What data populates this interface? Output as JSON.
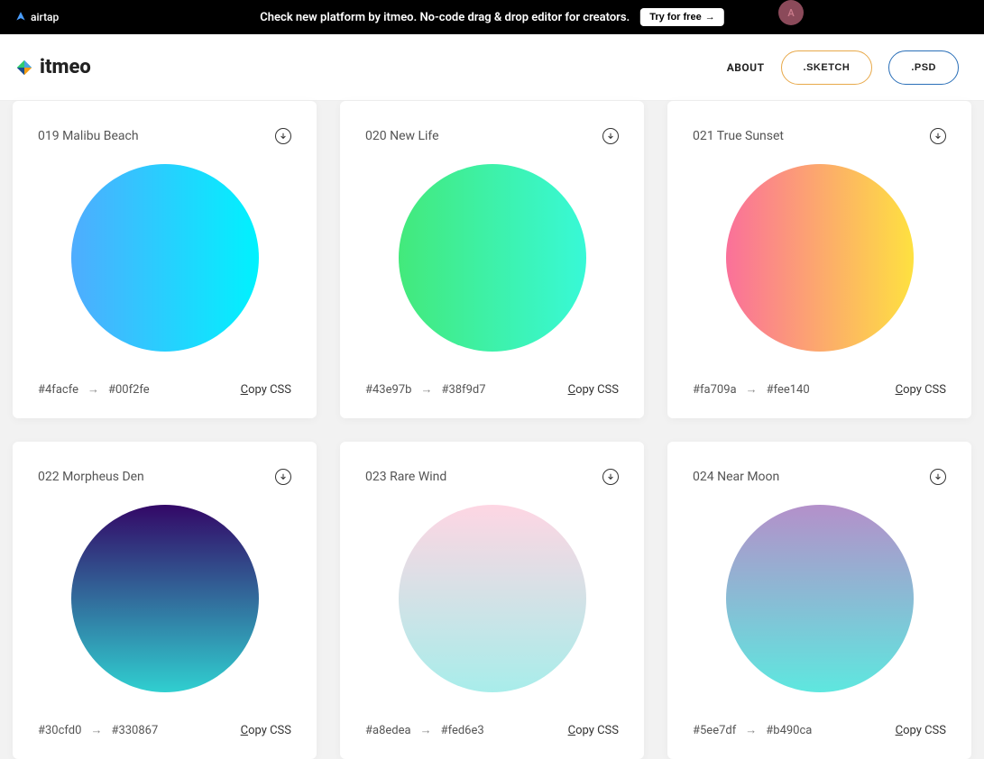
{
  "banner": {
    "logo_text": "airtap",
    "text": "Check new platform by itmeo. No-code drag & drop editor for creators.",
    "button": "Try for free",
    "avatar": "A"
  },
  "nav": {
    "logo": "itmeo",
    "about": "ABOUT",
    "sketch": ".SKETCH",
    "psd": ".PSD"
  },
  "cards": [
    {
      "title": "019 Malibu Beach",
      "from": "#4facfe",
      "to": "#00f2fe",
      "cls": "g-019"
    },
    {
      "title": "020 New Life",
      "from": "#43e97b",
      "to": "#38f9d7",
      "cls": "g-020"
    },
    {
      "title": "021 True Sunset",
      "from": "#fa709a",
      "to": "#fee140",
      "cls": "g-021"
    },
    {
      "title": "022 Morpheus Den",
      "from": "#30cfd0",
      "to": "#330867",
      "cls": "g-022"
    },
    {
      "title": "023 Rare Wind",
      "from": "#a8edea",
      "to": "#fed6e3",
      "cls": "g-023"
    },
    {
      "title": "024 Near Moon",
      "from": "#5ee7df",
      "to": "#b490ca",
      "cls": "g-024"
    }
  ],
  "copy_label": "opy CSS",
  "copy_prefix": "C",
  "arrow": "→"
}
